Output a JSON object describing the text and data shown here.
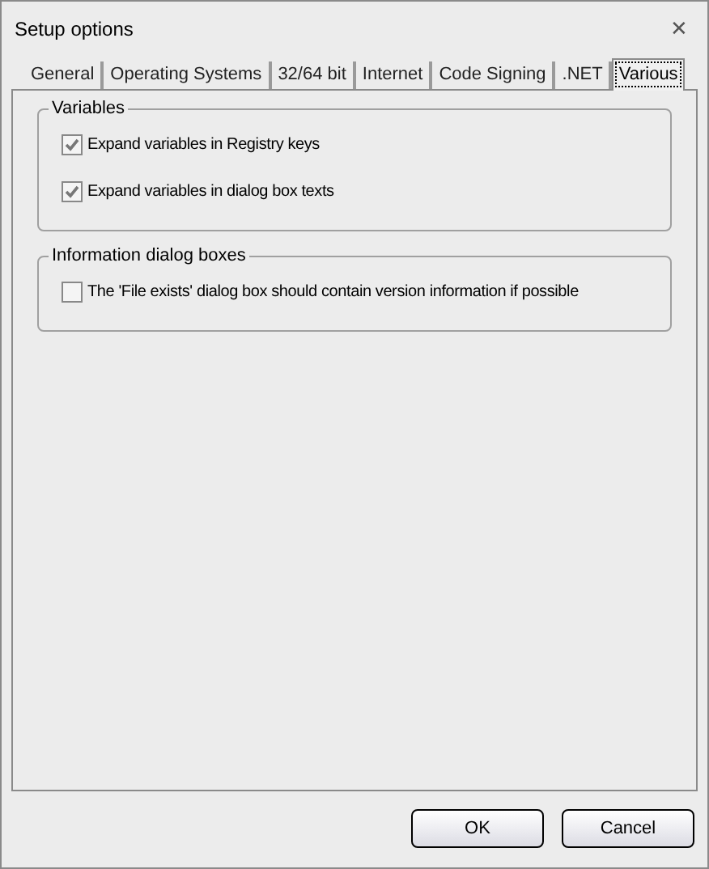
{
  "window": {
    "title": "Setup options",
    "close": "✕"
  },
  "tabs": [
    {
      "label": "General",
      "selected": false
    },
    {
      "label": "Operating Systems",
      "selected": false
    },
    {
      "label": "32/64 bit",
      "selected": false
    },
    {
      "label": "Internet",
      "selected": false
    },
    {
      "label": "Code Signing",
      "selected": false
    },
    {
      "label": ".NET",
      "selected": false
    },
    {
      "label": "Various",
      "selected": true
    }
  ],
  "groups": [
    {
      "title": "Variables",
      "options": [
        {
          "label": "Expand variables in Registry keys",
          "checked": true
        },
        {
          "label": "Expand variables in dialog box texts",
          "checked": true
        }
      ]
    },
    {
      "title": "Information dialog boxes",
      "options": [
        {
          "label": "The 'File exists' dialog box should contain version information if possible",
          "checked": false
        }
      ]
    }
  ],
  "buttons": [
    "OK",
    "Cancel"
  ]
}
